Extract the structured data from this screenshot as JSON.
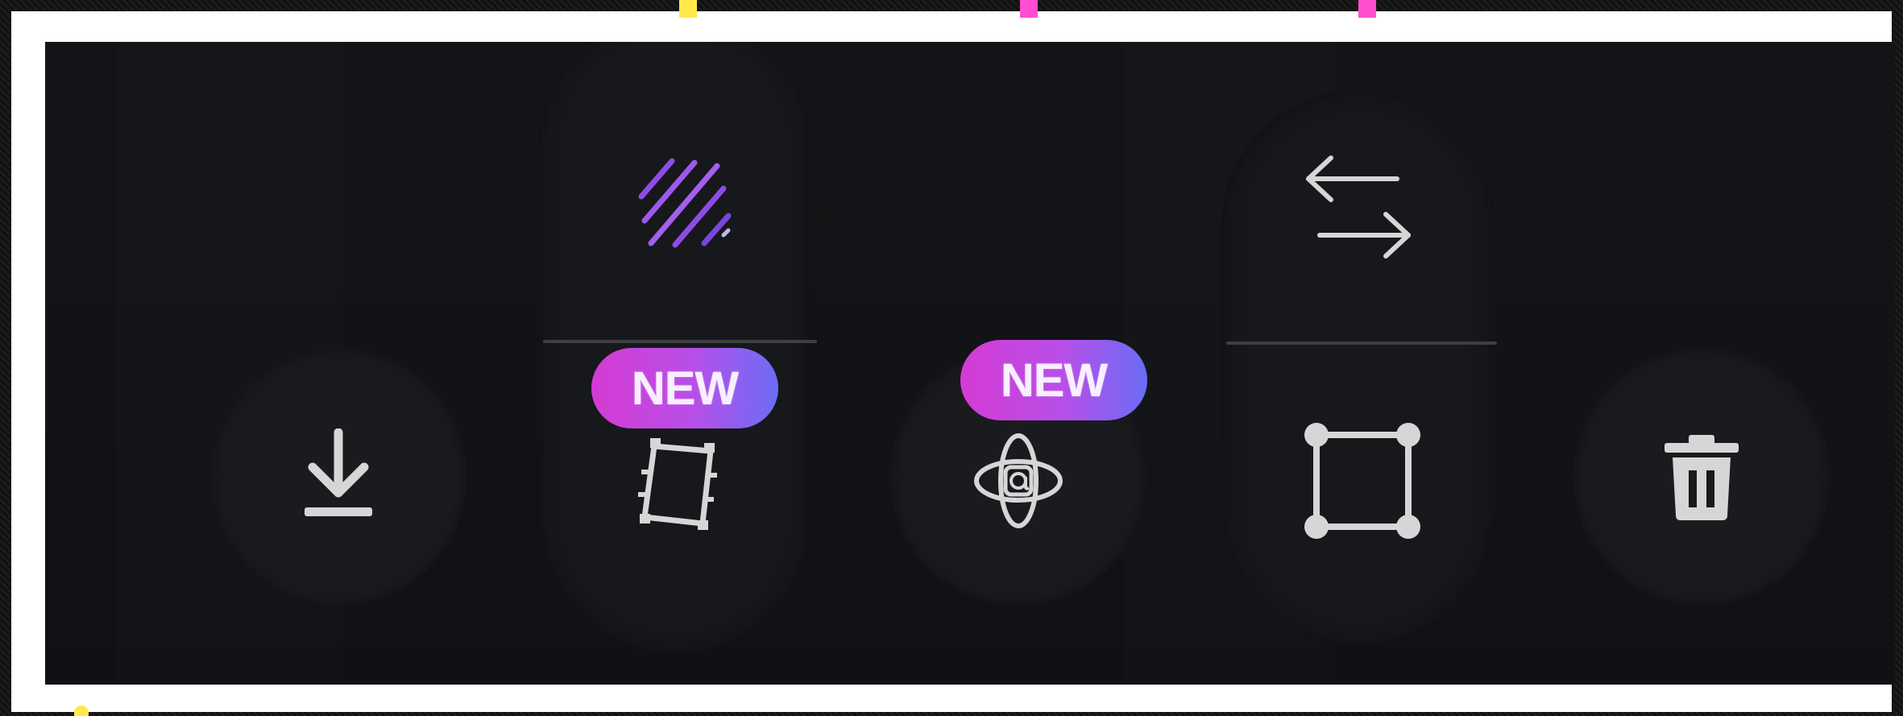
{
  "toolbar": {
    "actions": [
      {
        "id": "download",
        "icon": "download-icon"
      },
      {
        "id": "stripes",
        "icon": "diagonal-stripes-icon"
      },
      {
        "id": "video-frame",
        "icon": "film-frame-icon",
        "badge": "NEW"
      },
      {
        "id": "ar",
        "icon": "ar-atom-icon",
        "badge": "NEW"
      },
      {
        "id": "swap",
        "icon": "swap-arrows-icon"
      },
      {
        "id": "crop",
        "icon": "crop-square-icon"
      },
      {
        "id": "delete",
        "icon": "trash-icon"
      }
    ],
    "badge_new_1": "NEW",
    "badge_new_2": "NEW"
  },
  "colors": {
    "panel_bg": "#121417",
    "button_bg": "#191b1e",
    "icon": "#d6d6d6",
    "badge_start": "#d43bd3",
    "badge_end": "#6a6df6",
    "stripes_purple": "#8e4be8",
    "marker_yellow": "#ffe94a",
    "marker_pink": "#ff4fd0"
  }
}
